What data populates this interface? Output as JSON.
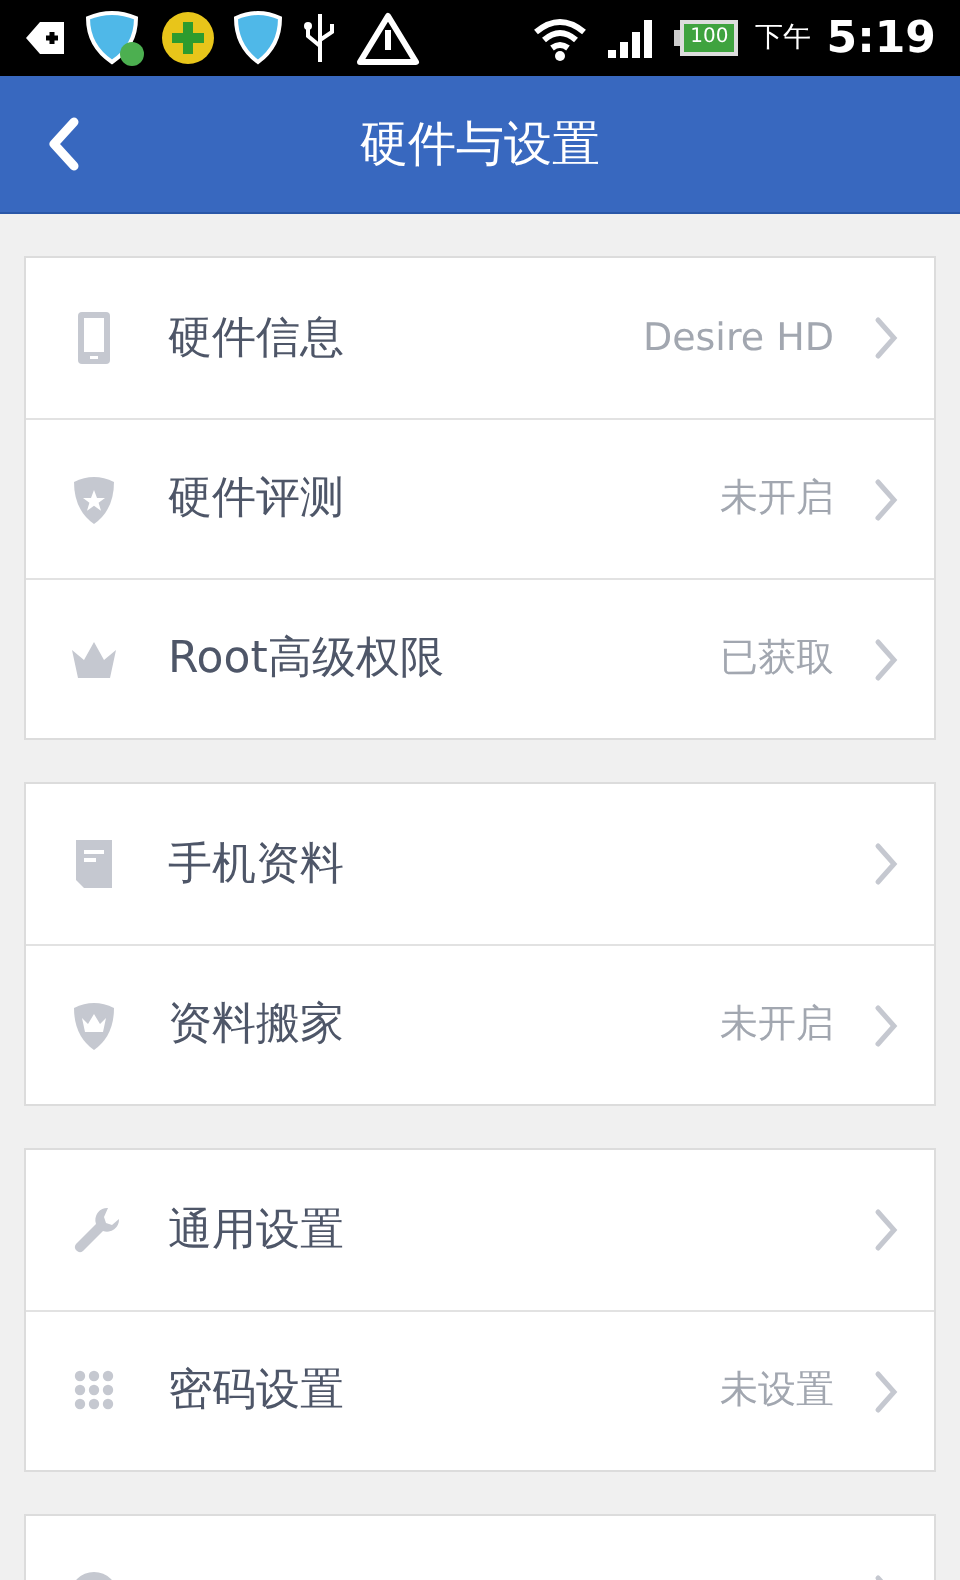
{
  "status_bar": {
    "period": "下午",
    "time": "5:19",
    "battery": "100"
  },
  "header": {
    "title": "硬件与设置"
  },
  "groups": [
    {
      "items": [
        {
          "kind": "phone",
          "label": "硬件信息",
          "value": "Desire HD"
        },
        {
          "kind": "shieldstar",
          "label": "硬件评测",
          "value": "未开启"
        },
        {
          "kind": "crown",
          "label": "Root高级权限",
          "value": "已获取"
        }
      ]
    },
    {
      "items": [
        {
          "kind": "document",
          "label": "手机资料"
        },
        {
          "kind": "shieldcrown",
          "label": "资料搬家",
          "value": "未开启"
        }
      ]
    },
    {
      "items": [
        {
          "kind": "wrench",
          "label": "通用设置"
        },
        {
          "kind": "keypad",
          "label": "密码设置",
          "value": "未设置"
        }
      ]
    },
    {
      "items": [
        {
          "kind": "info"
        }
      ]
    }
  ]
}
